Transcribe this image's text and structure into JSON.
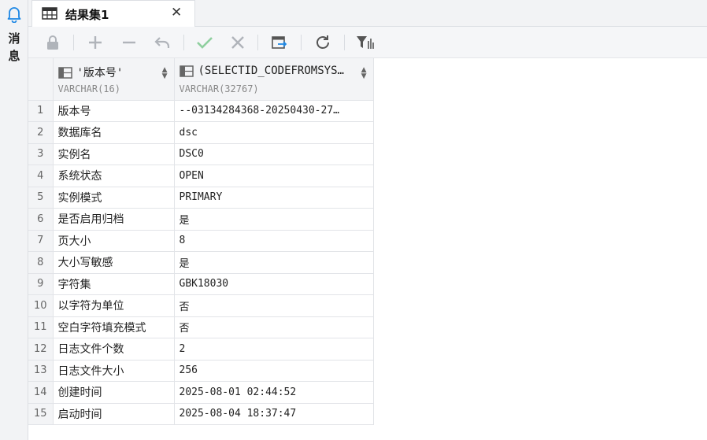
{
  "rail": {
    "label": "消息",
    "icon": "bell-icon"
  },
  "tab": {
    "label": "结果集1",
    "icon": "table-icon",
    "close_icon": "close-icon"
  },
  "toolbar": {
    "items": [
      "lock-icon",
      "add-icon",
      "remove-icon",
      "undo-icon",
      "commit-check-icon",
      "cancel-icon",
      "export-icon",
      "refresh-icon",
      "filter-icon"
    ]
  },
  "grid": {
    "columns": [
      {
        "name": "'版本号'",
        "type": "VARCHAR(16)"
      },
      {
        "name": "(SELECTID_CODEFROMSYS…",
        "type": "VARCHAR(32767)"
      }
    ],
    "rows": [
      {
        "n": "1",
        "a": "版本号",
        "b": "--03134284368-20250430-27…"
      },
      {
        "n": "2",
        "a": "数据库名",
        "b": "dsc"
      },
      {
        "n": "3",
        "a": "实例名",
        "b": "DSC0"
      },
      {
        "n": "4",
        "a": "系统状态",
        "b": "OPEN"
      },
      {
        "n": "5",
        "a": "实例模式",
        "b": "PRIMARY"
      },
      {
        "n": "6",
        "a": "是否启用归档",
        "b": "是"
      },
      {
        "n": "7",
        "a": "页大小",
        "b": "8"
      },
      {
        "n": "8",
        "a": "大小写敏感",
        "b": "是"
      },
      {
        "n": "9",
        "a": "字符集",
        "b": "GBK18030"
      },
      {
        "n": "10",
        "a": "以字符为单位",
        "b": "否"
      },
      {
        "n": "11",
        "a": "空白字符填充模式",
        "b": "否"
      },
      {
        "n": "12",
        "a": "日志文件个数",
        "b": "2"
      },
      {
        "n": "13",
        "a": "日志文件大小",
        "b": "256"
      },
      {
        "n": "14",
        "a": "创建时间",
        "b": "2025-08-01 02:44:52"
      },
      {
        "n": "15",
        "a": "启动时间",
        "b": "2025-08-04 18:37:47"
      }
    ]
  },
  "colors": {
    "accent": "#1e88e5",
    "check": "#5cb85c",
    "disabled": "#b0b4ba"
  }
}
